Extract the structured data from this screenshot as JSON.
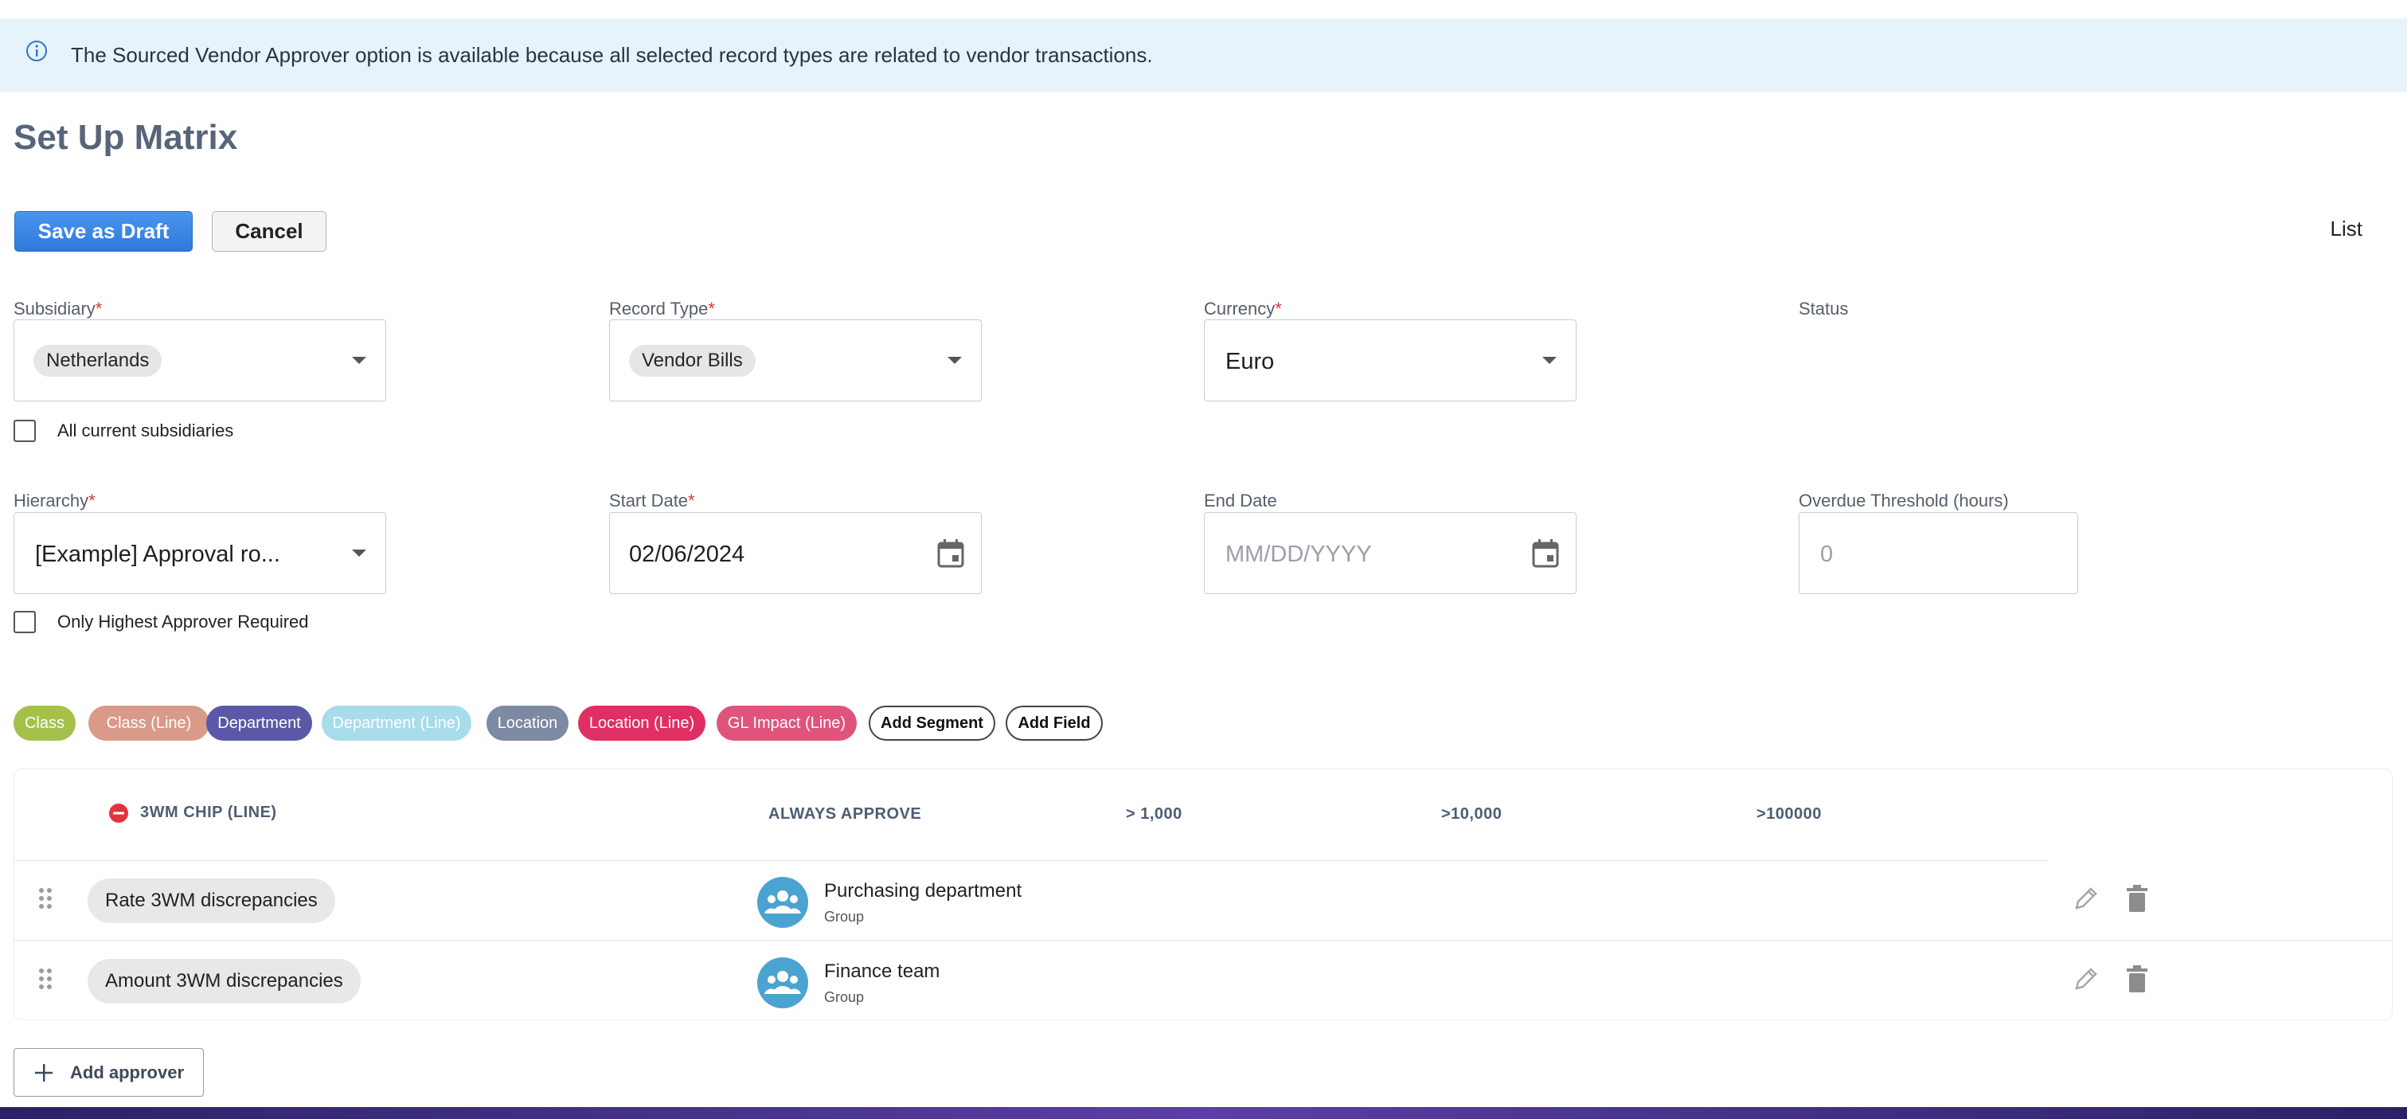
{
  "banner": {
    "icon": "info-icon",
    "text": "The Sourced Vendor Approver option is available because all selected record types are related to vendor transactions."
  },
  "page": {
    "title": "Set Up Matrix"
  },
  "actions": {
    "save_draft": "Save as Draft",
    "cancel": "Cancel",
    "list": "List"
  },
  "fields": {
    "subsidiary": {
      "label": "Subsidiary",
      "value": "Netherlands"
    },
    "record_type": {
      "label": "Record Type",
      "value": "Vendor Bills"
    },
    "currency": {
      "label": "Currency",
      "value": "Euro"
    },
    "status": {
      "label": "Status"
    },
    "all_subsidiaries": {
      "label": "All current subsidiaries",
      "checked": false
    },
    "hierarchy": {
      "label": "Hierarchy",
      "value": "[Example] Approval ro..."
    },
    "start_date": {
      "label": "Start Date",
      "value": "02/06/2024"
    },
    "end_date": {
      "label": "End Date",
      "placeholder": "MM/DD/YYYY"
    },
    "overdue": {
      "label": "Overdue Threshold (hours)",
      "placeholder": "0"
    },
    "highest_only": {
      "label": "Only Highest Approver Required",
      "checked": false
    }
  },
  "segments": [
    {
      "label": "Class",
      "color": "#a5c14a"
    },
    {
      "label": "Class (Line)",
      "color": "#d99a8a"
    },
    {
      "label": "Department",
      "color": "#5b58a8"
    },
    {
      "label": "Department (Line)",
      "color": "#a8dcea"
    },
    {
      "label": "Location",
      "color": "#7d8aa4"
    },
    {
      "label": "Location (Line)",
      "color": "#df2f63"
    },
    {
      "label": "GL Impact (Line)",
      "color": "#e0547c"
    },
    {
      "label": "Add Segment",
      "color": "#ffffff"
    },
    {
      "label": "Add Field",
      "color": "#ffffff"
    }
  ],
  "table": {
    "headers": {
      "chip": "3WM CHIP (LINE)",
      "always": "ALWAYS APPROVE",
      "t1": "> 1,000",
      "t2": ">10,000",
      "t3": ">100000"
    },
    "rows": [
      {
        "rule": "Rate 3WM discrepancies",
        "approver": "Purchasing department",
        "type": "Group"
      },
      {
        "rule": "Amount 3WM discrepancies",
        "approver": "Finance team",
        "type": "Group"
      }
    ]
  },
  "add_approver": "Add approver",
  "colors": {
    "accent": "#2f78dc",
    "required": "#d8363a",
    "avatar": "#4aa3d1",
    "banner_bg": "#e6f3fa"
  }
}
